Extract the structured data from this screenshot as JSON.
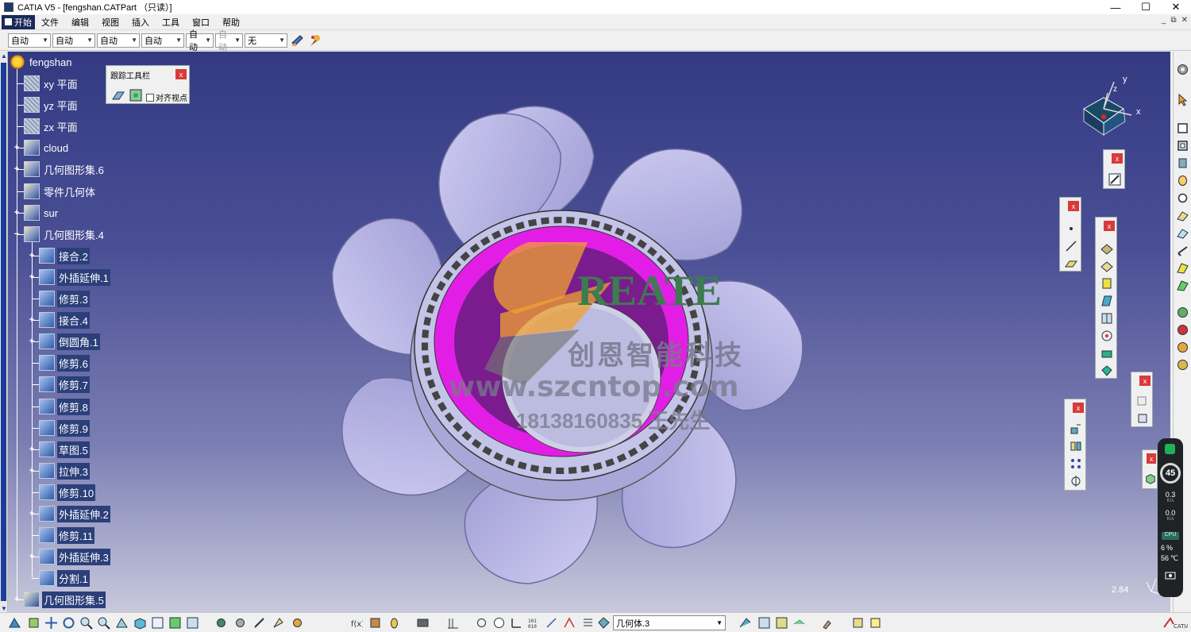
{
  "window": {
    "title": "CATIA V5 - [fengshan.CATPart （只读）]",
    "minimize": "—",
    "maximize": "☐",
    "close": "✕"
  },
  "menubar": {
    "start_label": "开始",
    "items": [
      "文件",
      "编辑",
      "视图",
      "插入",
      "工具",
      "窗口",
      "帮助"
    ],
    "mdi_controls": [
      "_",
      "⧉",
      "✕"
    ]
  },
  "top_toolbar": {
    "combos": [
      {
        "value": "自动",
        "disabled": false
      },
      {
        "value": "自动",
        "disabled": false
      },
      {
        "value": "自动",
        "disabled": false
      },
      {
        "value": "自动",
        "disabled": false
      },
      {
        "value": "自动",
        "disabled": false
      },
      {
        "value": "自动",
        "disabled": true
      },
      {
        "value": "无",
        "disabled": false
      }
    ],
    "icons": [
      "painter-icon",
      "format-brush-icon"
    ]
  },
  "spec_tree": {
    "root": "fengshan",
    "items": [
      {
        "label": "xy 平面",
        "depth": 1,
        "expander": "",
        "icon": "plane"
      },
      {
        "label": "yz 平面",
        "depth": 1,
        "expander": "",
        "icon": "plane"
      },
      {
        "label": "zx 平面",
        "depth": 1,
        "expander": "",
        "icon": "plane"
      },
      {
        "label": "cloud",
        "depth": 1,
        "expander": "+",
        "icon": "geo"
      },
      {
        "label": "几何图形集.6",
        "depth": 1,
        "expander": "+",
        "icon": "geo"
      },
      {
        "label": "零件几何体",
        "depth": 1,
        "expander": "",
        "icon": "geo"
      },
      {
        "label": "sur",
        "depth": 1,
        "expander": "+",
        "icon": "geo"
      },
      {
        "label": "几何图形集.4",
        "depth": 1,
        "expander": "−",
        "icon": "geo"
      },
      {
        "label": "接合.2",
        "depth": 2,
        "expander": "+",
        "icon": "op"
      },
      {
        "label": "外插延伸.1",
        "depth": 2,
        "expander": "+",
        "icon": "op"
      },
      {
        "label": "修剪.3",
        "depth": 2,
        "expander": "",
        "icon": "op"
      },
      {
        "label": "接合.4",
        "depth": 2,
        "expander": "+",
        "icon": "op"
      },
      {
        "label": "倒圆角.1",
        "depth": 2,
        "expander": "+",
        "icon": "op"
      },
      {
        "label": "修剪.6",
        "depth": 2,
        "expander": "",
        "icon": "op"
      },
      {
        "label": "修剪.7",
        "depth": 2,
        "expander": "",
        "icon": "op"
      },
      {
        "label": "修剪.8",
        "depth": 2,
        "expander": "",
        "icon": "op"
      },
      {
        "label": "修剪.9",
        "depth": 2,
        "expander": "",
        "icon": "op"
      },
      {
        "label": "草图.5",
        "depth": 2,
        "expander": "+",
        "icon": "op"
      },
      {
        "label": "拉伸.3",
        "depth": 2,
        "expander": "+",
        "icon": "op"
      },
      {
        "label": "修剪.10",
        "depth": 2,
        "expander": "",
        "icon": "op"
      },
      {
        "label": "外插延伸.2",
        "depth": 2,
        "expander": "+",
        "icon": "op"
      },
      {
        "label": "修剪.11",
        "depth": 2,
        "expander": "",
        "icon": "op"
      },
      {
        "label": "外插延伸.3",
        "depth": 2,
        "expander": "+",
        "icon": "op"
      },
      {
        "label": "分割.1",
        "depth": 2,
        "expander": "",
        "icon": "op"
      },
      {
        "label": "几何图形集.5",
        "depth": 1,
        "expander": "+",
        "icon": "geo"
      }
    ]
  },
  "tracking_toolbar": {
    "title": "跟踪工具栏",
    "close": "x",
    "checkbox_label": "对齐视点"
  },
  "compass": {
    "x": "x",
    "y": "y",
    "z": "z"
  },
  "watermark": {
    "brand": "REATE",
    "company": "创恩智能科技",
    "url": "www.szcntop.com",
    "contact": "18138160835 王先生"
  },
  "viewport": {
    "scale_readout": "2.84"
  },
  "perf_monitor": {
    "percent": "45",
    "upload": "0.3",
    "upload_unit": "K/s",
    "download": "0.0",
    "download_unit": "K/s",
    "cpu_label": "CPU",
    "cpu_usage": "6",
    "cpu_usage_unit": "%",
    "cpu_temp": "56",
    "cpu_temp_unit": "℃"
  },
  "bottom_toolbar": {
    "current_body": "几何体.3"
  },
  "colors": {
    "viewport_top": "#333a82",
    "viewport_bottom": "#c8c9dc",
    "fan_blade": "#b7b5e6",
    "ring_magenta": "#e21ee6",
    "watermark_orange": "#f0a030",
    "watermark_green": "#3e7b4f"
  }
}
